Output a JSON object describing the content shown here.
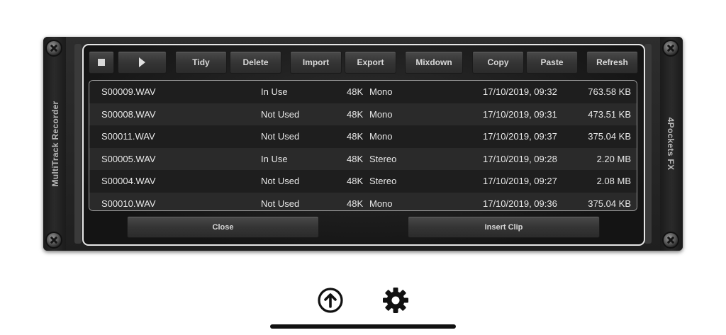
{
  "rack": {
    "left_label": "MultiTrack Recorder",
    "right_label": "4Pockets FX"
  },
  "toolbar": {
    "stop_icon": "stop-icon",
    "play_icon": "play-icon",
    "tidy": "Tidy",
    "delete": "Delete",
    "import": "Import",
    "export": "Export",
    "mixdown": "Mixdown",
    "copy": "Copy",
    "paste": "Paste",
    "refresh": "Refresh"
  },
  "files": [
    {
      "name": "S00009.WAV",
      "status": "In Use",
      "rate": "48K",
      "channels": "Mono",
      "date": "17/10/2019, 09:32",
      "size": "763.58 KB"
    },
    {
      "name": "S00008.WAV",
      "status": "Not Used",
      "rate": "48K",
      "channels": "Mono",
      "date": "17/10/2019, 09:31",
      "size": "473.51 KB"
    },
    {
      "name": "S00011.WAV",
      "status": "Not Used",
      "rate": "48K",
      "channels": "Mono",
      "date": "17/10/2019, 09:37",
      "size": "375.04 KB"
    },
    {
      "name": "S00005.WAV",
      "status": "In Use",
      "rate": "48K",
      "channels": "Stereo",
      "date": "17/10/2019, 09:28",
      "size": "2.20 MB"
    },
    {
      "name": "S00004.WAV",
      "status": "Not Used",
      "rate": "48K",
      "channels": "Stereo",
      "date": "17/10/2019, 09:27",
      "size": "2.08 MB"
    },
    {
      "name": "S00010.WAV",
      "status": "Not Used",
      "rate": "48K",
      "channels": "Mono",
      "date": "17/10/2019, 09:36",
      "size": "375.04 KB"
    }
  ],
  "actions": {
    "close": "Close",
    "insert_clip": "Insert Clip"
  },
  "system": {
    "upload_icon": "upload-icon",
    "settings_icon": "gear-icon"
  }
}
